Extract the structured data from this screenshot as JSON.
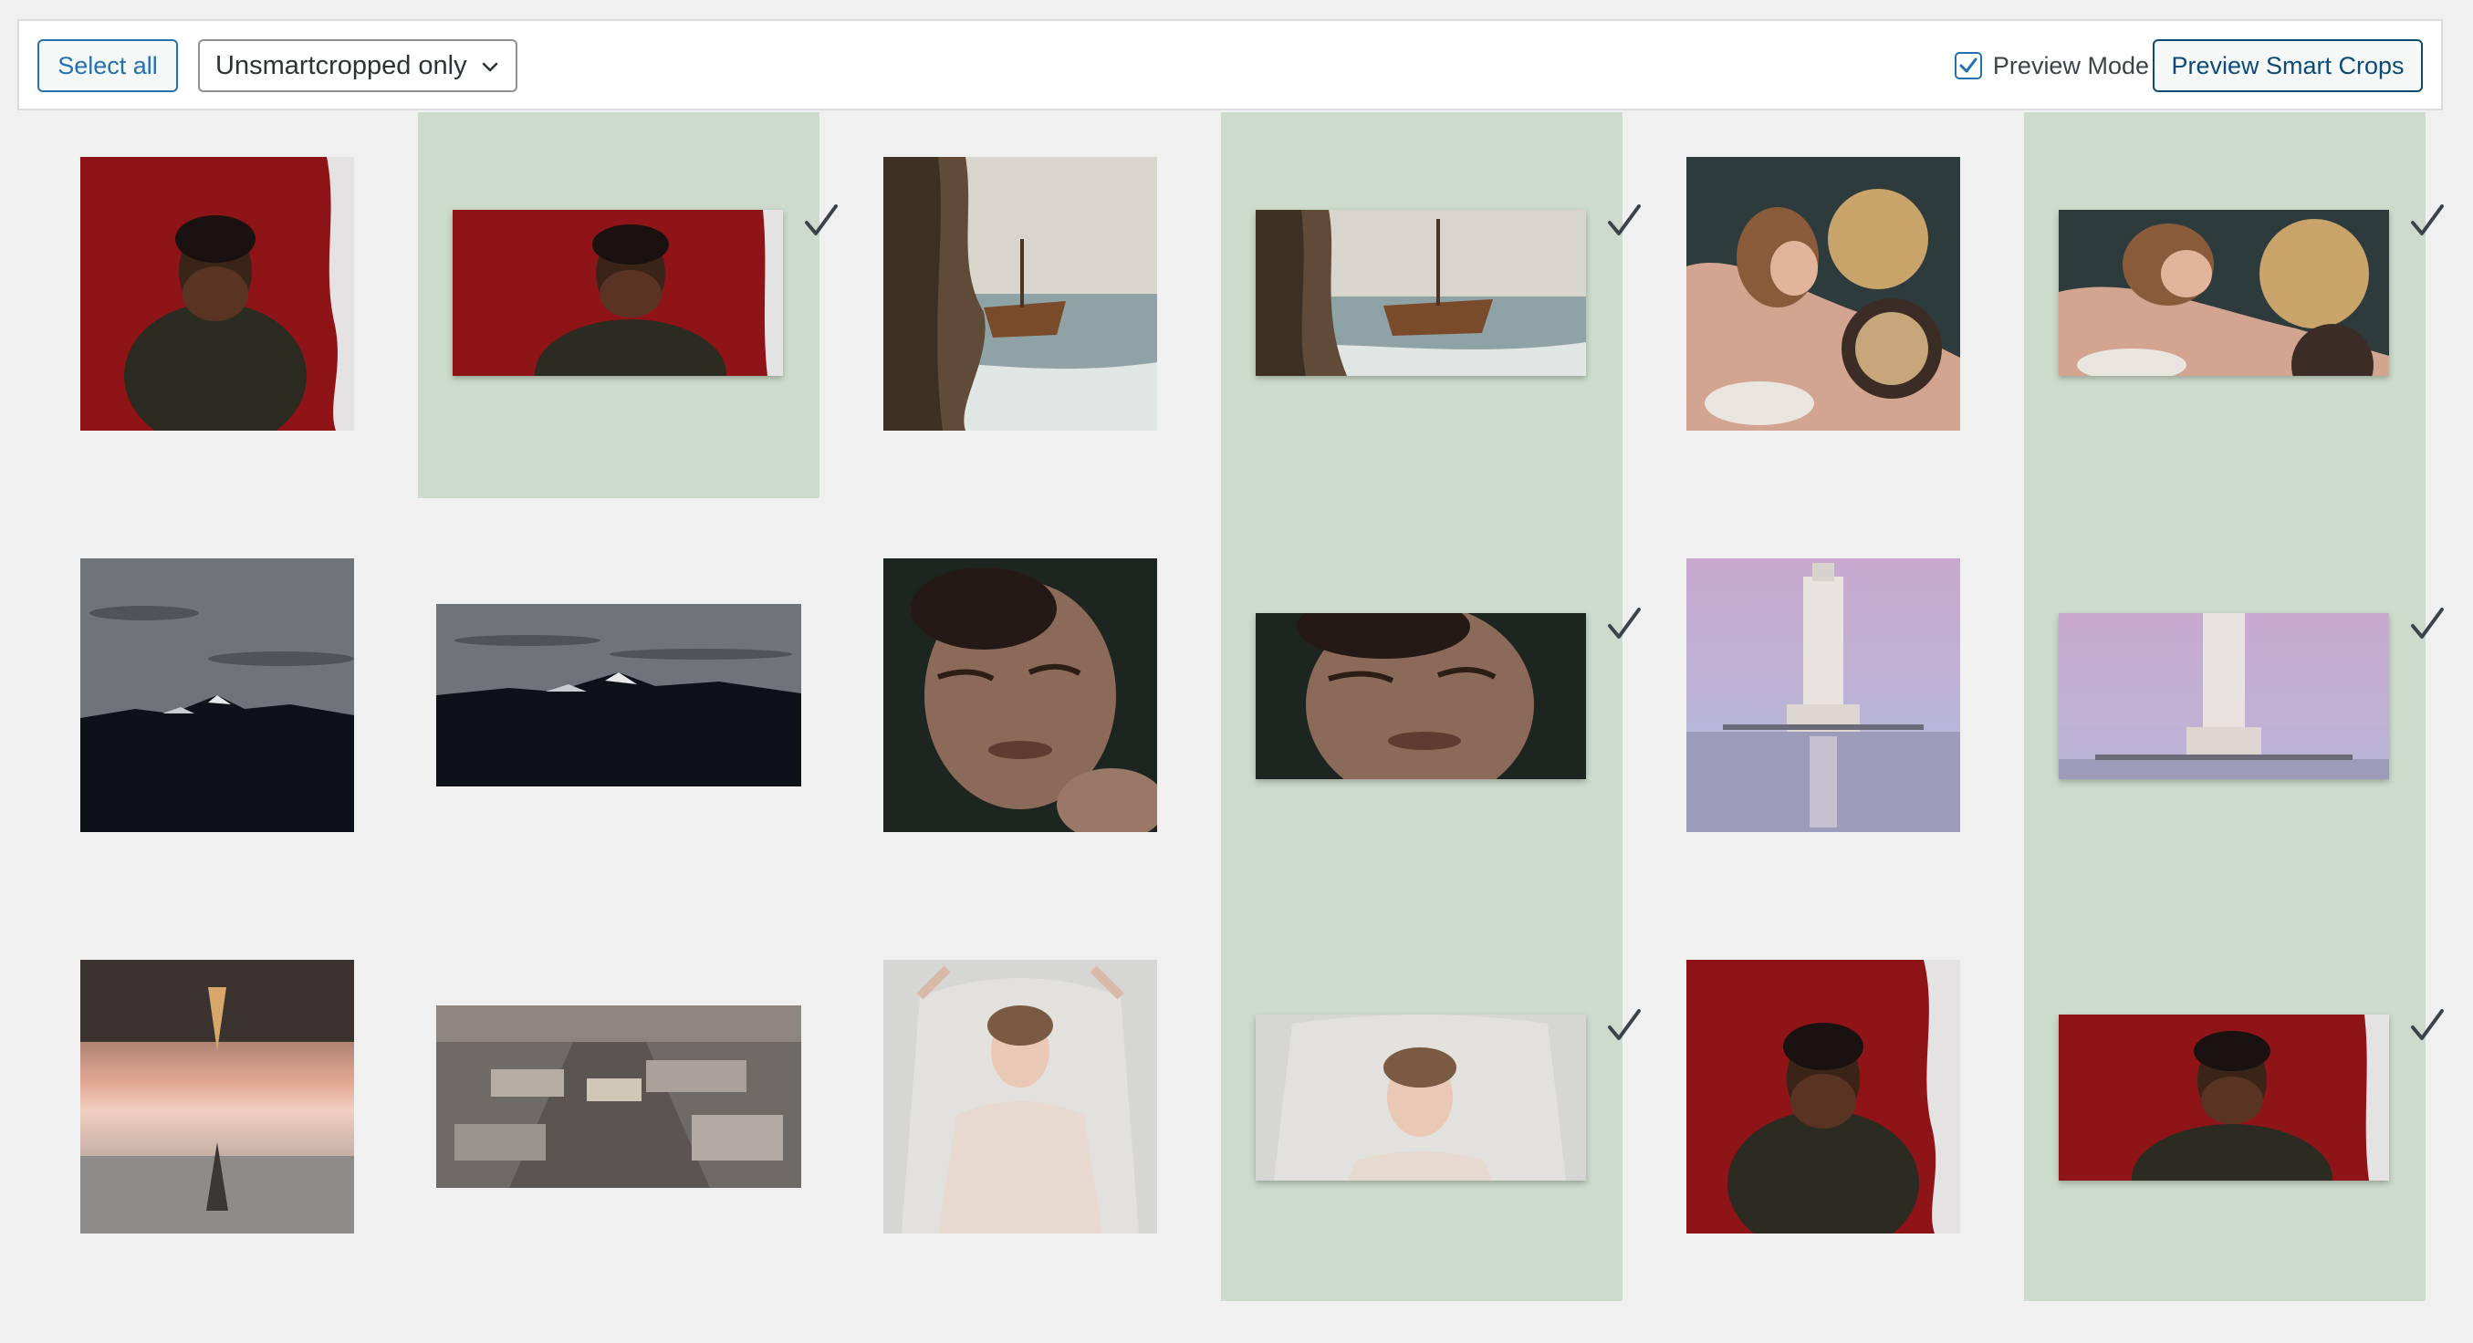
{
  "toolbar": {
    "select_all_label": "Select all",
    "filter_selected": "Unsmartcropped only",
    "preview_mode_label": "Preview Mode",
    "preview_mode_checked": true,
    "preview_button_label": "Preview Smart Crops"
  },
  "colors": {
    "accent": "#2271b1",
    "preview_column_bg": "#ccdbcb",
    "page_bg": "#f0f0f1"
  },
  "images": [
    {
      "subject": "man-covering-face-red",
      "cropped": false
    },
    {
      "subject": "man-covering-face-red",
      "cropped": true,
      "preview": true
    },
    {
      "subject": "shipwreck-through-rocks",
      "cropped": false
    },
    {
      "subject": "shipwreck-through-rocks",
      "cropped": true,
      "preview": true
    },
    {
      "subject": "baroque-woman-portrait",
      "cropped": false
    },
    {
      "subject": "baroque-woman-portrait",
      "cropped": true,
      "preview": true
    },
    {
      "subject": "snowy-mountains",
      "cropped": false
    },
    {
      "subject": "snowy-mountains",
      "cropped": true,
      "preview": false
    },
    {
      "subject": "sleeping-man",
      "cropped": false
    },
    {
      "subject": "sleeping-man",
      "cropped": true,
      "preview": true
    },
    {
      "subject": "flooded-bell-tower",
      "cropped": false
    },
    {
      "subject": "flooded-bell-tower",
      "cropped": true,
      "preview": true
    },
    {
      "subject": "mirrored-eiffel-tower",
      "cropped": false
    },
    {
      "subject": "paris-aerial",
      "cropped": true,
      "preview": false
    },
    {
      "subject": "woman-in-veil",
      "cropped": false
    },
    {
      "subject": "woman-in-veil",
      "cropped": true,
      "preview": true
    },
    {
      "subject": "man-covering-face-red",
      "cropped": false
    },
    {
      "subject": "man-covering-face-red",
      "cropped": true,
      "preview": true
    }
  ],
  "icons": {
    "check": "checkmark-icon",
    "chevron": "chevron-down-icon"
  }
}
